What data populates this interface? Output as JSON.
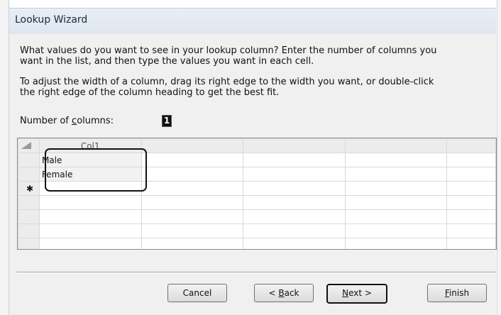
{
  "window": {
    "title": "Lookup Wizard"
  },
  "instructions": {
    "line1a": "What values do you want to see in your lookup column? Enter the number of columns you",
    "line1b": "want in the list, and then type the values you want in each cell.",
    "line2a": "To adjust the width of a column, drag its right edge to the width you want, or double-click",
    "line2b": "the right edge of the column heading to get the best fit."
  },
  "number_of_columns": {
    "label_pre": "Number of ",
    "label_key": "c",
    "label_post": "olumns:",
    "value": "1"
  },
  "grid": {
    "column_header": "Col1",
    "rows": [
      {
        "selector": "",
        "value": "Male"
      },
      {
        "selector": "",
        "value": "Female"
      },
      {
        "selector": "✱",
        "value": ""
      }
    ]
  },
  "buttons": {
    "cancel": "Cancel",
    "back_pre": "< ",
    "back_key": "B",
    "back_post": "ack",
    "next_key": "N",
    "next_post": "ext >",
    "finish_key": "F",
    "finish_post": "inish"
  }
}
